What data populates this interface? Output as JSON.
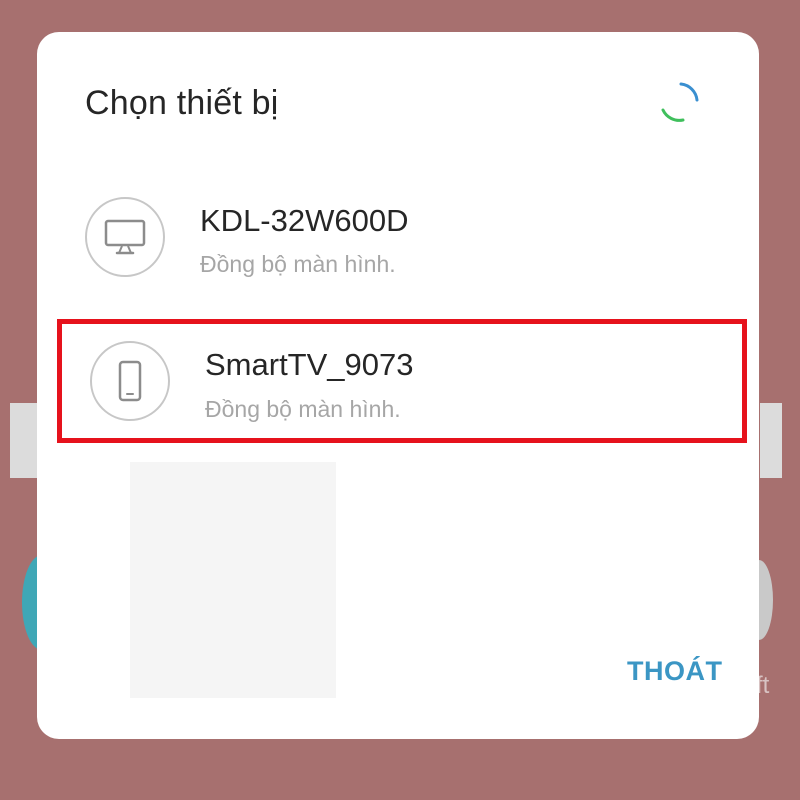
{
  "background": {
    "partial_text": "ft"
  },
  "dialog": {
    "title": "Chọn thiết bị",
    "devices": [
      {
        "name": "KDL-32W600D",
        "subtitle": "Đồng bộ màn hình.",
        "icon": "tv-icon",
        "highlighted": false
      },
      {
        "name": "SmartTV_9073",
        "subtitle": "Đồng bộ màn hình.",
        "icon": "phone-icon",
        "highlighted": true
      }
    ],
    "exit_label": "THOÁT"
  },
  "colors": {
    "background": "#a7706f",
    "highlight": "#e6121c",
    "accent": "#3b96c4",
    "spinner_blue": "#3a8fd0",
    "spinner_green": "#3fbf5c"
  }
}
